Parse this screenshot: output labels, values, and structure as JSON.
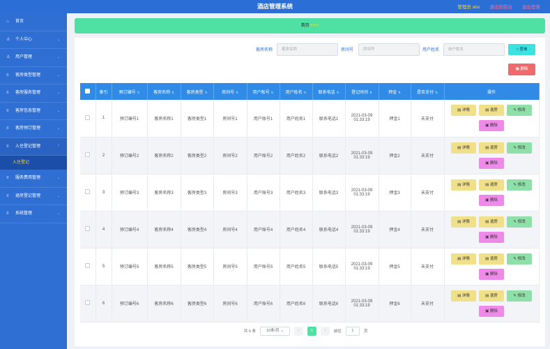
{
  "header": {
    "title": "酒店管理系统",
    "admin_label": "管理员 abo",
    "switch_label": "退出到前台",
    "logout_label": "退出登录"
  },
  "sidebar": {
    "items": [
      {
        "label": "首页",
        "icon": "home-icon"
      },
      {
        "label": "个人中心",
        "icon": "user-icon"
      },
      {
        "label": "用户管理",
        "icon": "user-icon"
      },
      {
        "label": "客房类型管理",
        "icon": "menu-icon"
      },
      {
        "label": "客房服务管理",
        "icon": "menu-icon"
      },
      {
        "label": "客房信息管理",
        "icon": "menu-icon"
      },
      {
        "label": "客房预订管理",
        "icon": "menu-icon"
      },
      {
        "label": "入住登记管理",
        "icon": "menu-icon"
      },
      {
        "label": "服务费用管理",
        "icon": "menu-icon"
      },
      {
        "label": "退房登记管理",
        "icon": "menu-icon"
      },
      {
        "label": "系统管理",
        "icon": "menu-icon"
      }
    ],
    "active_sub": "入住登记"
  },
  "breadcrumb": {
    "label": "首页"
  },
  "search": {
    "room_name_label": "客房名称",
    "room_name_placeholder": "客房名称",
    "room_no_label": "房间号",
    "room_no_placeholder": "房间号",
    "user_name_label": "用户姓名",
    "user_name_placeholder": "用户姓名",
    "query_label": "查询",
    "delete_label": "删除"
  },
  "table": {
    "headers": [
      "索引",
      "预订编号",
      "客房名称",
      "客房类型",
      "房间号",
      "用户账号",
      "用户姓名",
      "联系电话",
      "登记时间",
      "押金",
      "是否支付",
      "操作"
    ],
    "rows": [
      {
        "idx": "1",
        "order": "预订编号1",
        "room_name": "客房名称1",
        "room_type": "客房类型1",
        "room_no": "房间号1",
        "account": "用户账号1",
        "user": "用户姓名1",
        "phone": "联系电话1",
        "date": "2021-03-09",
        "time": "01:33:19",
        "deposit": "押金1",
        "paid": "未支付"
      },
      {
        "idx": "2",
        "order": "预订编号2",
        "room_name": "客房名称2",
        "room_type": "客房类型2",
        "room_no": "房间号2",
        "account": "用户账号2",
        "user": "用户姓名2",
        "phone": "联系电话2",
        "date": "2021-03-09",
        "time": "01:33:19",
        "deposit": "押金2",
        "paid": "未支付"
      },
      {
        "idx": "3",
        "order": "预订编号3",
        "room_name": "客房名称3",
        "room_type": "客房类型3",
        "room_no": "房间号3",
        "account": "用户账号3",
        "user": "用户姓名3",
        "phone": "联系电话3",
        "date": "2021-03-09",
        "time": "01:33:19",
        "deposit": "押金3",
        "paid": "未支付"
      },
      {
        "idx": "4",
        "order": "预订编号4",
        "room_name": "客房名称4",
        "room_type": "客房类型4",
        "room_no": "房间号4",
        "account": "用户账号4",
        "user": "用户姓名4",
        "phone": "联系电话4",
        "date": "2021-03-09",
        "time": "01:33:19",
        "deposit": "押金4",
        "paid": "未支付"
      },
      {
        "idx": "5",
        "order": "预订编号5",
        "room_name": "客房名称5",
        "room_type": "客房类型5",
        "room_no": "房间号5",
        "account": "用户账号5",
        "user": "用户姓名5",
        "phone": "联系电话5",
        "date": "2021-03-09",
        "time": "01:33:19",
        "deposit": "押金5",
        "paid": "未支付"
      },
      {
        "idx": "6",
        "order": "预订编号6",
        "room_name": "客房名称6",
        "room_type": "客房类型6",
        "room_no": "房间号6",
        "account": "用户账号6",
        "user": "用户姓名6",
        "phone": "联系电话6",
        "date": "2021-03-09",
        "time": "01:33:19",
        "deposit": "押金6",
        "paid": "未支付"
      }
    ],
    "actions": {
      "detail": "详情",
      "return": "退房",
      "edit": "修改",
      "delete": "删除"
    }
  },
  "pager": {
    "total": "共 6 条",
    "page_size": "10条/页",
    "prev": "‹",
    "current": "1",
    "next": "›",
    "goto_label": "前往",
    "goto_value": "1",
    "page_unit": "页"
  },
  "colors": {
    "topbar": "#2b6fd6",
    "sidebar": "#2f6ed3",
    "breadcrumb": "#4fe0a4",
    "table_header": "#2f8be6",
    "query_button": "#3be2e0",
    "delete_button": "#ef6a6a"
  }
}
